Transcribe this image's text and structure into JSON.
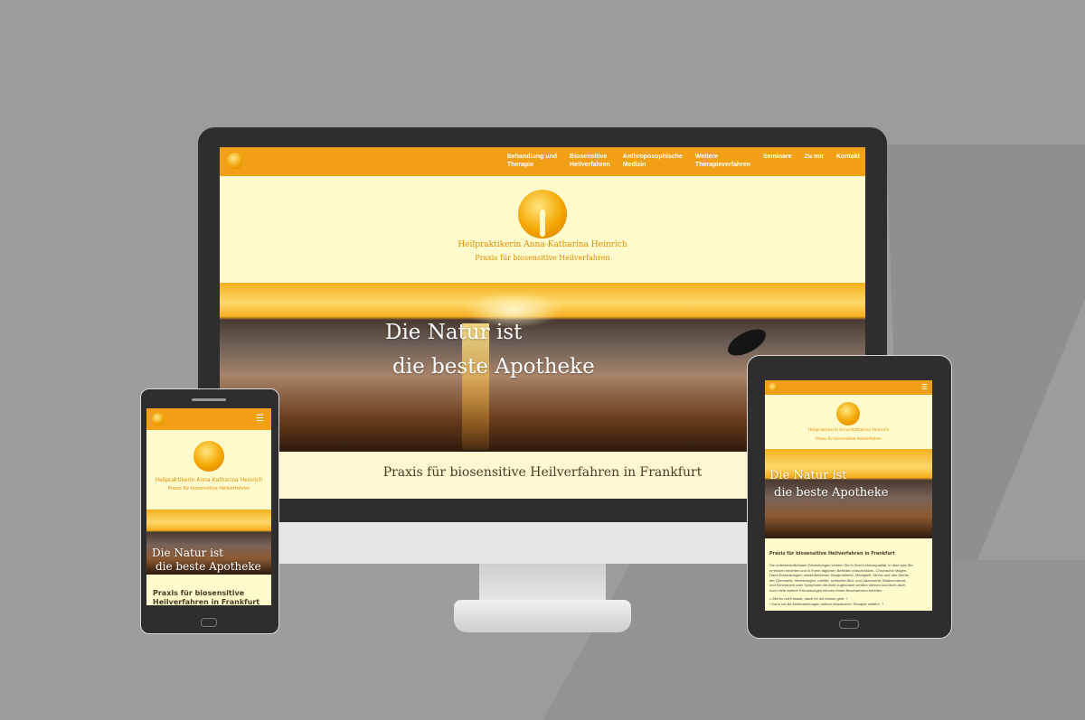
{
  "desktop": {
    "nav": [
      {
        "line1": "Behandlung und",
        "line2": "Therapie"
      },
      {
        "line1": "Biosensitive",
        "line2": "Heilverfahren"
      },
      {
        "line1": "Anthroposophische",
        "line2": "Medizin"
      },
      {
        "line1": "Weitere",
        "line2": "Therapieverfahren"
      },
      {
        "line1": "Seminare",
        "line2": ""
      },
      {
        "line1": "Zu mir",
        "line2": ""
      },
      {
        "line1": "Kontakt",
        "line2": ""
      }
    ],
    "site_name": "Heilpraktikerin Anna-Katharina Heinrich",
    "site_tagline": "Praxis für biosensitive Heilverfahren",
    "hero_line1": "Die Natur ist",
    "hero_line2": "die beste Apotheke",
    "section_heading": "Praxis für biosensitive Heilverfahren in Frankfurt"
  },
  "phone": {
    "menu_icon": "hamburger-icon",
    "site_name": "Heilpraktikerin Anna-Katharina Heinrich",
    "site_tagline": "Praxis für biosensitive Heilverfahren",
    "hero_line1": "Die Natur ist",
    "hero_line2": "die beste Apotheke",
    "heading_line1": "Praxis für biosensitive",
    "heading_line2": "Heilverfahren in Frankfurt"
  },
  "tablet": {
    "menu_icon": "hamburger-icon",
    "site_name": "Heilpraktikerin Anna-Katharina Heinrich",
    "site_tagline": "Praxis für biosensitive Heilverfahren",
    "hero_line1": "Die Natur ist",
    "hero_line2": "die beste Apotheke",
    "heading": "Praxis für biosensitive Heilverfahren in Frankfurt",
    "body_lines": [
      "Die unterschiedlichsten Erkrankungen können Sie in Ihrer Lebensqualität, in dem was Sie",
      "erreichen möchten und in  Ihrem täglichen Befinden einschränken. Chronische Magen-",
      "Darm Erkrankungen, wiederkehrende Hautprobleme,  Müdigkeit, Stress und das Gefühl",
      "der Ohnmacht, Verletzungen, Unfälle, schlechte Blut- und Laborwerte, Bluthochdruck",
      " und Schmerzen oder Symptome die nicht zugeordnet werden können und doch auch",
      "noch viele weitere Erkrankungen  können Ihnen Beschwerden bereiten."
    ],
    "bullets": [
      "• Gibt es nicht etwas, damit es mir besser geht. ?",
      "• Kann ich die Nebenwirkungen meiner klassischen Therapie mildern. ?"
    ]
  },
  "colors": {
    "background": "#9c9c9c",
    "device_frame": "#2f2d2e",
    "nav_orange": "#f1a016",
    "page_cream": "#fffbcc",
    "brand_text": "#e08a00"
  }
}
